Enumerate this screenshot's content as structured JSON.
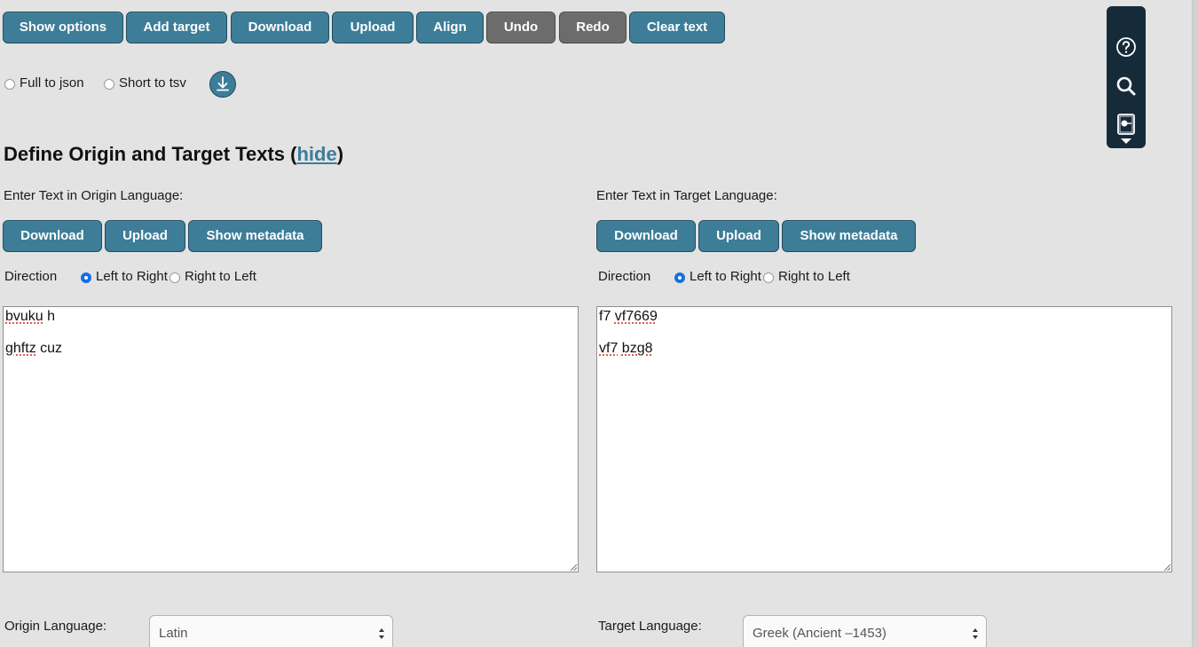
{
  "toolbar": {
    "show_options": "Show options",
    "add_target": "Add target",
    "download": "Download",
    "upload": "Upload",
    "align": "Align",
    "undo": "Undo",
    "redo": "Redo",
    "clear_text": "Clear text"
  },
  "export": {
    "full_to_json": "Full to json",
    "short_to_tsv": "Short to tsv",
    "download_icon": "download-arrow-icon"
  },
  "section": {
    "title_prefix": "Define Origin and Target Texts (",
    "hide_link": "hide",
    "title_suffix": ")"
  },
  "origin": {
    "enter_label": "Enter Text in Origin Language:",
    "download": "Download",
    "upload": "Upload",
    "show_metadata": "Show metadata",
    "direction_label": "Direction",
    "ltr": "Left to Right",
    "rtl": "Right to Left",
    "direction_selected": "ltr",
    "lines": [
      {
        "words": [
          {
            "t": "bvuku",
            "spell": true
          },
          {
            "t": " h",
            "spell": false
          }
        ]
      },
      {
        "words": [
          {
            "t": "ghftz",
            "spell": true
          },
          {
            "t": " cuz",
            "spell": false
          }
        ]
      }
    ],
    "language_label": "Origin Language:",
    "language_value": "Latin"
  },
  "target": {
    "enter_label": "Enter Text in Target Language:",
    "download": "Download",
    "upload": "Upload",
    "show_metadata": "Show metadata",
    "direction_label": "Direction",
    "ltr": "Left to Right",
    "rtl": "Right to Left",
    "direction_selected": "ltr",
    "lines": [
      {
        "words": [
          {
            "t": "f7 ",
            "spell": false
          },
          {
            "t": "vf7669",
            "spell": true
          }
        ]
      },
      {
        "words": [
          {
            "t": "vf7",
            "spell": true
          },
          {
            "t": " ",
            "spell": false
          },
          {
            "t": "bzg8",
            "spell": true
          }
        ]
      }
    ],
    "language_label": "Target Language:",
    "language_value": "Greek (Ancient –1453)"
  },
  "side_toolbar": {
    "icons": [
      "help-icon",
      "search-icon",
      "reader-icon"
    ]
  },
  "colors": {
    "accent": "#3d7d98",
    "disabled": "#6c6c6c",
    "background": "#e3e3e3",
    "toolbar_dark": "#152b3a",
    "radio_selected": "#1670e0"
  }
}
